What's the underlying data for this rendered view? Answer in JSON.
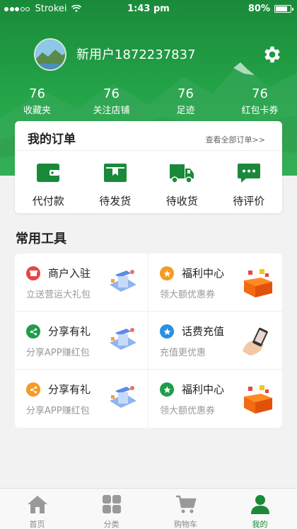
{
  "status_bar": {
    "carrier": "Strokei",
    "time": "1:43 pm",
    "battery": "80%",
    "battery_level": 0.8
  },
  "profile": {
    "username": "新用户1872237837"
  },
  "stats": [
    {
      "value": "76",
      "label": "收藏夹"
    },
    {
      "value": "76",
      "label": "关注店铺"
    },
    {
      "value": "76",
      "label": "足迹"
    },
    {
      "value": "76",
      "label": "红包卡券"
    }
  ],
  "orders": {
    "title": "我的订单",
    "view_all": "查看全部订单>>",
    "items": [
      {
        "label": "代付款",
        "icon": "wallet-icon"
      },
      {
        "label": "待发货",
        "icon": "package-icon"
      },
      {
        "label": "待收货",
        "icon": "truck-icon"
      },
      {
        "label": "待评价",
        "icon": "chat-icon"
      }
    ]
  },
  "tools": {
    "title": "常用工具",
    "items": [
      {
        "title": "商户入驻",
        "subtitle": "立送营运大礼包",
        "icon": "store-icon",
        "color": "#e94545"
      },
      {
        "title": "福利中心",
        "subtitle": "领大额优惠券",
        "icon": "star-icon",
        "color": "#f59a23"
      },
      {
        "title": "分享有礼",
        "subtitle": "分享APP赚红包",
        "icon": "share-icon",
        "color": "#1f9d4a"
      },
      {
        "title": "话费充值",
        "subtitle": "充值更优惠",
        "icon": "star-icon",
        "color": "#2a8fe0"
      },
      {
        "title": "分享有礼",
        "subtitle": "分享APP赚红包",
        "icon": "share-icon",
        "color": "#f59a23"
      },
      {
        "title": "福利中心",
        "subtitle": "领大额优惠券",
        "icon": "star-icon",
        "color": "#1f9d4a"
      }
    ]
  },
  "tabbar": {
    "items": [
      {
        "label": "首页",
        "icon": "home-icon",
        "active": false
      },
      {
        "label": "分类",
        "icon": "grid-icon",
        "active": false
      },
      {
        "label": "购物车",
        "icon": "cart-icon",
        "active": false
      },
      {
        "label": "我的",
        "icon": "user-icon",
        "active": true
      }
    ]
  },
  "colors": {
    "brand": "#1a8a3a",
    "header_light": "#2fb552"
  }
}
